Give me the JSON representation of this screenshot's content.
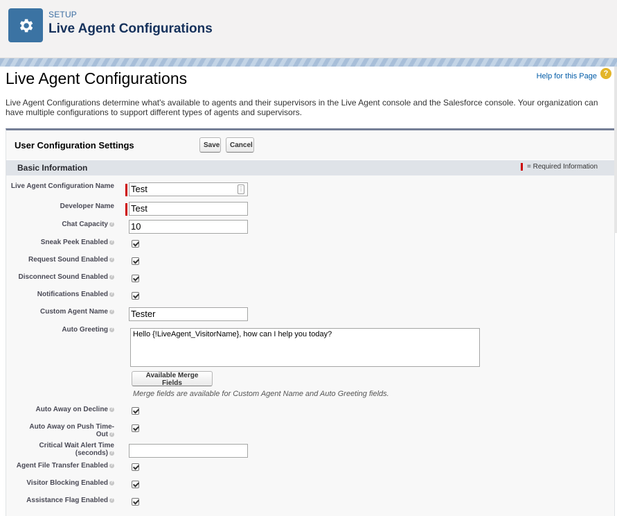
{
  "header": {
    "kicker": "SETUP",
    "title": "Live Agent Configurations",
    "icon": "gear-icon"
  },
  "page": {
    "title": "Live Agent Configurations",
    "help_link": "Help for this Page",
    "help_icon": "?",
    "description": "Live Agent Configurations determine what's available to agents and their supervisors in the Live Agent console and the Salesforce console. Your organization can have multiple configurations to support different types of agents and supervisors."
  },
  "panel": {
    "title": "User Configuration Settings",
    "save_label": "Save",
    "cancel_label": "Cancel"
  },
  "section": {
    "title": "Basic Information",
    "required_text": "= Required Information"
  },
  "fields": {
    "config_name": {
      "label": "Live Agent Configuration Name",
      "value": "Test"
    },
    "developer_name": {
      "label": "Developer Name",
      "value": "Test"
    },
    "chat_capacity": {
      "label": "Chat Capacity",
      "value": "10"
    },
    "sneak_peek": {
      "label": "Sneak Peek Enabled",
      "checked": true
    },
    "request_sound": {
      "label": "Request Sound Enabled",
      "checked": true
    },
    "disconnect_sound": {
      "label": "Disconnect Sound Enabled",
      "checked": true
    },
    "notifications": {
      "label": "Notifications Enabled",
      "checked": true
    },
    "custom_agent_name": {
      "label": "Custom Agent Name",
      "value": "Tester"
    },
    "auto_greeting": {
      "label": "Auto Greeting",
      "value": "Hello {!LiveAgent_VisitorName}, how can I help you today?"
    },
    "merge_button": "Available Merge Fields",
    "merge_note": "Merge fields are available for Custom Agent Name and Auto Greeting fields.",
    "auto_away_decline": {
      "label": "Auto Away on Decline",
      "checked": true
    },
    "auto_away_push": {
      "label": "Auto Away on Push Time-Out",
      "checked": true
    },
    "critical_wait": {
      "label": "Critical Wait Alert Time (seconds)",
      "value": ""
    },
    "file_transfer": {
      "label": "Agent File Transfer Enabled",
      "checked": true
    },
    "visitor_blocking": {
      "label": "Visitor Blocking Enabled",
      "checked": true
    },
    "assistance_flag": {
      "label": "Assistance Flag Enabled",
      "checked": true
    }
  },
  "colors": {
    "brand_blue": "#3b73a3",
    "required_red": "#cc0000",
    "help_icon": "#e3b52a"
  }
}
